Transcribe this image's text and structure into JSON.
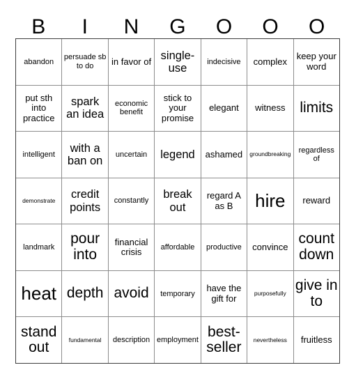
{
  "card": {
    "title": "BINGO card",
    "header_letters": [
      "B",
      "I",
      "N",
      "G",
      "O",
      "O",
      "O"
    ],
    "columns": 7,
    "rows": 7,
    "colors": {
      "background": "#ffffff",
      "text": "#000000",
      "inner_border": "#8c8c8c",
      "outer_border": "#3b3b3b"
    },
    "cells": [
      [
        {
          "text": "abandon",
          "size": "s"
        },
        {
          "text": "persuade sb to do",
          "size": "s"
        },
        {
          "text": "in favor of",
          "size": "m"
        },
        {
          "text": "single-use",
          "size": "l"
        },
        {
          "text": "indecisive",
          "size": "s"
        },
        {
          "text": "complex",
          "size": "m"
        },
        {
          "text": "keep your word",
          "size": "m"
        }
      ],
      [
        {
          "text": "put sth into practice",
          "size": "m"
        },
        {
          "text": "spark an idea",
          "size": "l"
        },
        {
          "text": "economic benefit",
          "size": "s"
        },
        {
          "text": "stick to your promise",
          "size": "m"
        },
        {
          "text": "elegant",
          "size": "m"
        },
        {
          "text": "witness",
          "size": "m"
        },
        {
          "text": "limits",
          "size": "xl"
        }
      ],
      [
        {
          "text": "intelligent",
          "size": "s"
        },
        {
          "text": "with a ban on",
          "size": "l"
        },
        {
          "text": "uncertain",
          "size": "s"
        },
        {
          "text": "legend",
          "size": "l"
        },
        {
          "text": "ashamed",
          "size": "m"
        },
        {
          "text": "groundbreaking",
          "size": "xs"
        },
        {
          "text": "regardless of",
          "size": "s"
        }
      ],
      [
        {
          "text": "demonstrate",
          "size": "xs"
        },
        {
          "text": "credit points",
          "size": "l"
        },
        {
          "text": "constantly",
          "size": "s"
        },
        {
          "text": "break out",
          "size": "l"
        },
        {
          "text": "regard A as B",
          "size": "m"
        },
        {
          "text": "hire",
          "size": "xxl"
        },
        {
          "text": "reward",
          "size": "m"
        }
      ],
      [
        {
          "text": "landmark",
          "size": "s"
        },
        {
          "text": "pour into",
          "size": "xl"
        },
        {
          "text": "financial crisis",
          "size": "m"
        },
        {
          "text": "affordable",
          "size": "s"
        },
        {
          "text": "productive",
          "size": "s"
        },
        {
          "text": "convince",
          "size": "m"
        },
        {
          "text": "count down",
          "size": "xl"
        }
      ],
      [
        {
          "text": "heat",
          "size": "xxl"
        },
        {
          "text": "depth",
          "size": "xl"
        },
        {
          "text": "avoid",
          "size": "xl"
        },
        {
          "text": "temporary",
          "size": "s"
        },
        {
          "text": "have the gift for",
          "size": "m"
        },
        {
          "text": "purposefully",
          "size": "xs"
        },
        {
          "text": "give in to",
          "size": "xl"
        }
      ],
      [
        {
          "text": "stand out",
          "size": "xl"
        },
        {
          "text": "fundamental",
          "size": "xs"
        },
        {
          "text": "description",
          "size": "s"
        },
        {
          "text": "employment",
          "size": "s"
        },
        {
          "text": "best-seller",
          "size": "xl"
        },
        {
          "text": "nevertheless",
          "size": "xs"
        },
        {
          "text": "fruitless",
          "size": "m"
        }
      ]
    ]
  }
}
